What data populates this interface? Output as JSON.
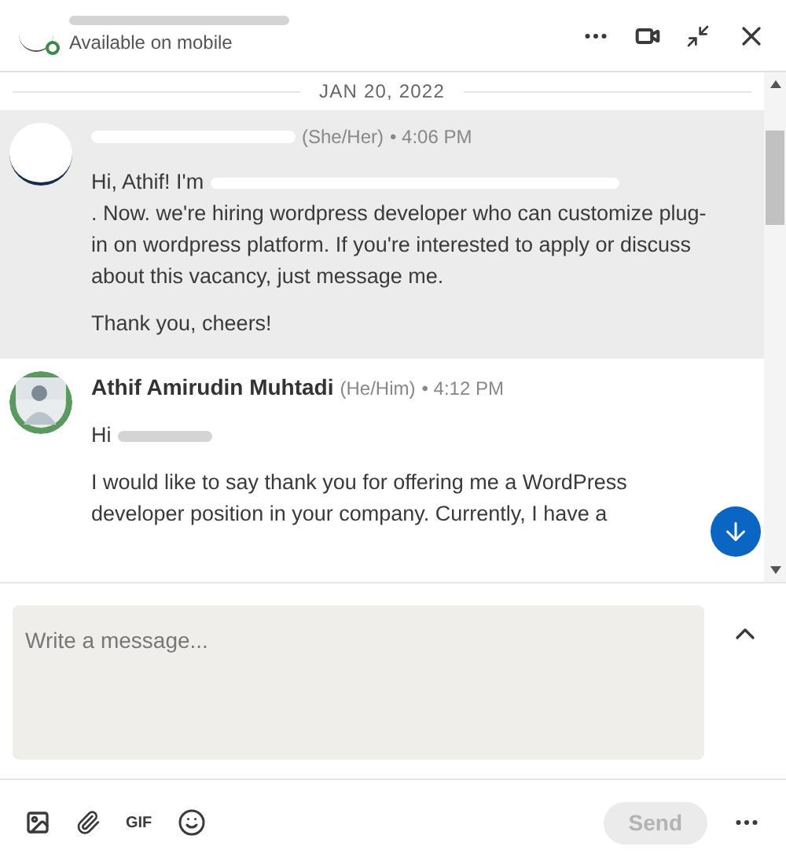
{
  "header": {
    "status": "Available on mobile",
    "online": true
  },
  "date_divider": "JAN 20, 2022",
  "messages": [
    {
      "pronouns": "(She/Her)",
      "time": "• 4:06 PM",
      "highlighted": true,
      "paragraphs": [
        {
          "lead": "Hi, Athif! I'm",
          "text": ". Now. we're hiring wordpress developer who can customize plug-in on wordpress platform. If you're interested to apply or discuss about this vacancy, just message me."
        },
        {
          "text": "Thank you, cheers!"
        }
      ]
    },
    {
      "author": "Athif Amirudin Muhtadi",
      "pronouns": "(He/Him)",
      "time": "• 4:12 PM",
      "highlighted": false,
      "paragraphs": [
        {
          "lead": "Hi"
        },
        {
          "text": "I would like to say thank you for offering me a WordPress developer position in your company. Currently, I have a"
        }
      ]
    }
  ],
  "composer": {
    "placeholder": "Write a message...",
    "send": "Send",
    "send_disabled": true,
    "gif": "GIF"
  }
}
